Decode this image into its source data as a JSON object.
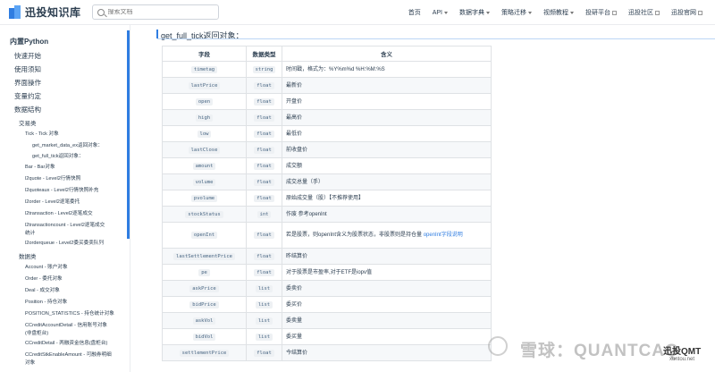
{
  "header": {
    "logo_text": "迅投知识库",
    "search_placeholder": "搜索文档",
    "nav": [
      {
        "label": "首页",
        "caret": false,
        "ext": false
      },
      {
        "label": "API",
        "caret": true,
        "ext": false
      },
      {
        "label": "数据字典",
        "caret": true,
        "ext": false
      },
      {
        "label": "策略迁移",
        "caret": true,
        "ext": false
      },
      {
        "label": "视频教程",
        "caret": true,
        "ext": false
      },
      {
        "label": "投研平台",
        "caret": false,
        "ext": true
      },
      {
        "label": "迅投社区",
        "caret": false,
        "ext": true
      },
      {
        "label": "迅投官网",
        "caret": false,
        "ext": true
      }
    ]
  },
  "sidebar": {
    "title": "内置Python",
    "items": [
      {
        "level": 1,
        "label": "快速开始"
      },
      {
        "level": 1,
        "label": "使用须知"
      },
      {
        "level": 1,
        "label": "界面操作"
      },
      {
        "level": 1,
        "label": "变量约定"
      },
      {
        "level": 1,
        "label": "数据结构"
      },
      {
        "level": 2,
        "label": "交易类"
      },
      {
        "level": 3,
        "label": "Tick - Tick 对象"
      },
      {
        "level": 4,
        "label": "get_market_data_ex返回对象："
      },
      {
        "level": 4,
        "label": "get_full_tick返回对象："
      },
      {
        "level": 3,
        "label": "Bar - Bar对象"
      },
      {
        "level": 3,
        "label": "l2quote - Level2行情快照"
      },
      {
        "level": 3,
        "label": "l2quoteaux - Level2行情快照补充"
      },
      {
        "level": 3,
        "label": "l2order - Level2逐笔委托"
      },
      {
        "level": 3,
        "label": "l2transaction - Level2逐笔成交"
      },
      {
        "level": 3,
        "label": "l2transactioncount - Level2逐笔成交",
        "label2": "统计"
      },
      {
        "level": 3,
        "label": "l2orderqueue - Level2委买委卖队列"
      },
      {
        "level": 2,
        "label": "数据类"
      },
      {
        "level": 3,
        "label": "Account - 账户对象"
      },
      {
        "level": 3,
        "label": "Order - 委托对象"
      },
      {
        "level": 3,
        "label": "Deal - 成交对象"
      },
      {
        "level": 3,
        "label": "Position - 持仓对象"
      },
      {
        "level": 3,
        "label": "POSITION_STATISTICS - 持仓统计对象"
      },
      {
        "level": 3,
        "label": "CCreditAccountDetail - 信用账号对象",
        "label2": "(非盘柜台)"
      },
      {
        "level": 3,
        "label": "CCreditDetail - 两融资金信息(盘柜台)"
      },
      {
        "level": 3,
        "label": "CCreditStkEnableAmount - 可融券明细",
        "label2": "对象"
      }
    ]
  },
  "main": {
    "heading": "get_full_tick返回对象：",
    "table": {
      "headers": [
        "字段",
        "数据类型",
        "含义"
      ],
      "rows": [
        {
          "field": "timetag",
          "type": "string",
          "desc": "时间戳，格式为：%Y%m%d %H:%M:%S"
        },
        {
          "field": "lastPrice",
          "type": "float",
          "desc": "最新价"
        },
        {
          "field": "open",
          "type": "float",
          "desc": "开盘价"
        },
        {
          "field": "high",
          "type": "float",
          "desc": "最高价"
        },
        {
          "field": "low",
          "type": "float",
          "desc": "最低价"
        },
        {
          "field": "lastClose",
          "type": "float",
          "desc": "前收盘价"
        },
        {
          "field": "amount",
          "type": "float",
          "desc": "成交额"
        },
        {
          "field": "volume",
          "type": "float",
          "desc": "成交总量（手）"
        },
        {
          "field": "pvolume",
          "type": "float",
          "desc": "原始成交量（股）【不推荐使用】"
        },
        {
          "field": "stockStatus",
          "type": "int",
          "desc": "作废 参考openInt"
        },
        {
          "field": "openInt",
          "type": "float",
          "desc": "若是股票，则openInt含义为股票状态，非股票则是持仓量 ",
          "link": "openInt字段说明"
        },
        {
          "field": "lastSettlementPrice",
          "type": "float",
          "desc": "昨结算价"
        },
        {
          "field": "pe",
          "type": "float",
          "desc": "对于股票是市盈率,对于ETF是iopv值"
        },
        {
          "field": "askPrice",
          "type": "list",
          "desc": "委卖价"
        },
        {
          "field": "bidPrice",
          "type": "list",
          "desc": "委买价"
        },
        {
          "field": "askVol",
          "type": "list",
          "desc": "委卖量"
        },
        {
          "field": "bidVol",
          "type": "list",
          "desc": "委买量"
        },
        {
          "field": "settlementPrice",
          "type": "float",
          "desc": "今结算价"
        }
      ]
    }
  },
  "watermark": {
    "text": "雪球：QUANTCAQ",
    "logo": "迅投QMT",
    "sub": "xuntou.net"
  }
}
